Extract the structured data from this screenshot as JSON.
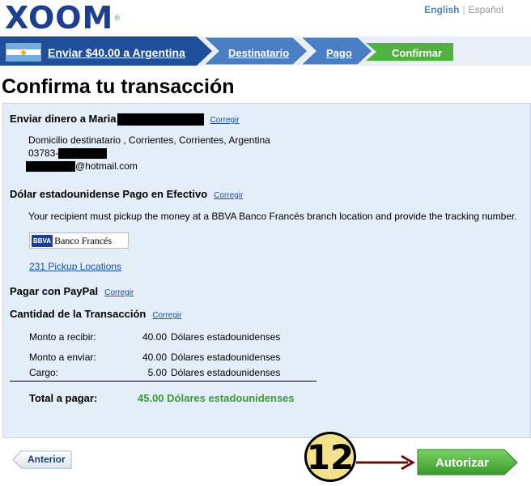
{
  "header": {
    "logo": "XOOM",
    "lang_english": "English",
    "lang_sep": "|",
    "lang_spanish": "Español"
  },
  "steps": {
    "step1": "Enviar $40.00 a Argentina",
    "step2": "Destinatario",
    "step3": "Pago",
    "step4": "Confirmar"
  },
  "page_title": "Confirma tu transacción",
  "recipient": {
    "heading": "Enviar dinero a Maria",
    "edit": "Corregir",
    "address": "Domicilio destinatario , Corrientes, Corrientes, Argentina",
    "phone_prefix": "03783-",
    "email_suffix": "@hotmail.com"
  },
  "delivery": {
    "heading": "Dólar estadounidense Pago en Efectivo",
    "edit": "Corregir",
    "note": "Your recipient must pickup the money at a BBVA Banco Francés branch location and provide the tracking number.",
    "bank_logo_mark": "BBVA",
    "bank_logo_name": "Banco Francés",
    "pickup_link": "231 Pickup Locations"
  },
  "payment": {
    "heading": "Pagar con PayPal",
    "edit": "Corregir"
  },
  "amount": {
    "heading": "Cantidad de la Transacción",
    "edit": "Corregir",
    "rows": [
      {
        "label": "Monto a recibir:",
        "value": "40.00",
        "currency": "Dólares estadounidenses"
      },
      {
        "label": "Monto a enviar:",
        "value": "40.00",
        "currency": "Dólares estadounidenses"
      },
      {
        "label": "Cargo:",
        "value": "5.00",
        "currency": "Dólares estadounidenses"
      }
    ],
    "total_label": "Total a pagar:",
    "total_value": "45.00 Dólares estadounidenses"
  },
  "buttons": {
    "back": "Anterior",
    "authorize": "Autorizar"
  },
  "annotation": {
    "step_number": "12"
  },
  "colors": {
    "brand_blue": "#1d3f8f",
    "brand_green": "#3ea340",
    "total_green": "#3b9b32"
  }
}
